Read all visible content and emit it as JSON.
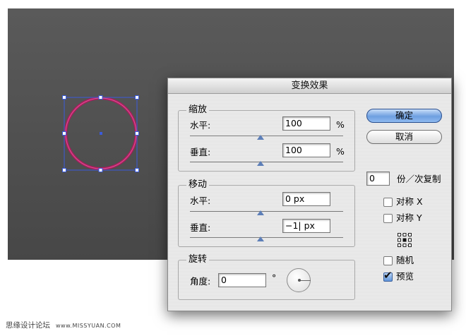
{
  "dialog": {
    "title": "变换效果",
    "scale": {
      "title": "缩放",
      "horizontal_label": "水平:",
      "horizontal_value": "100",
      "horizontal_unit": "%",
      "vertical_label": "垂直:",
      "vertical_value": "100",
      "vertical_unit": "%"
    },
    "move": {
      "title": "移动",
      "horizontal_label": "水平:",
      "horizontal_value": "0 px",
      "vertical_label": "垂直:",
      "vertical_value": "−1| px"
    },
    "rotate": {
      "title": "旋转",
      "angle_label": "角度:",
      "angle_value": "0",
      "angle_unit": "°"
    },
    "buttons": {
      "ok": "确定",
      "cancel": "取消"
    },
    "copies": {
      "value": "0",
      "label": "份／次复制"
    },
    "options": {
      "reflect_x": {
        "label": "对称 X",
        "checked": false
      },
      "reflect_y": {
        "label": "对称 Y",
        "checked": false
      },
      "random": {
        "label": "随机",
        "checked": false
      },
      "preview": {
        "label": "预览",
        "checked": true
      }
    }
  },
  "colors": {
    "accent": "#5d7fb8",
    "circle_stroke": "#b0195e",
    "selection": "#3b5bdb",
    "canvas": "#4f4f4f"
  },
  "footer": {
    "site_name": "思缘设计论坛",
    "site_url": "www.MISSYUAN.COM"
  }
}
